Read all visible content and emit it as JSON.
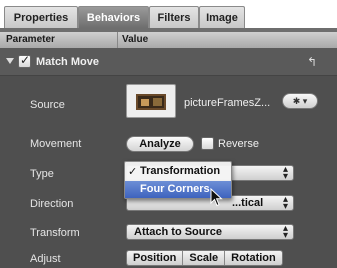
{
  "tabs": [
    {
      "label": "Properties"
    },
    {
      "label": "Behaviors"
    },
    {
      "label": "Filters"
    },
    {
      "label": "Image"
    }
  ],
  "active_tab": "Behaviors",
  "header": {
    "parameter": "Parameter",
    "value": "Value"
  },
  "group": {
    "title": "Match Move",
    "checked": true
  },
  "rows": {
    "source": {
      "label": "Source",
      "filename": "pictureFramesZ...",
      "gear_symbol": "✱ ▾"
    },
    "movement": {
      "label": "Movement",
      "analyze": "Analyze",
      "reverse": "Reverse"
    },
    "type": {
      "label": "Type"
    },
    "direction": {
      "label": "Direction",
      "value_partial": "...tical"
    },
    "transform": {
      "label": "Transform",
      "value": "Attach to Source"
    },
    "adjust": {
      "label": "Adjust",
      "segments": [
        "Position",
        "Scale",
        "Rotation"
      ]
    }
  },
  "dropdown_menu": {
    "items": [
      {
        "label": "Transformation",
        "checked": true,
        "check_symbol": "✓"
      },
      {
        "label": "Four Corners",
        "selected": true
      }
    ]
  },
  "colors": {
    "panel_bg": "#4f4f4f",
    "menu_highlight": "#3e63be"
  }
}
